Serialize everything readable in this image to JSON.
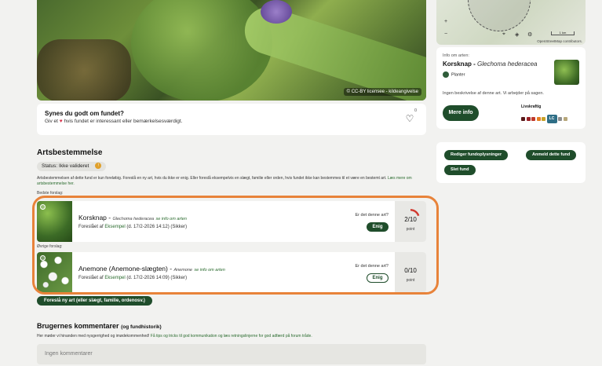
{
  "photo": {
    "credit": "© CC-BY licensee - kildeangivelse"
  },
  "like": {
    "title": "Synes du godt om fundet?",
    "desc_pre": "Giv et",
    "desc_post": "hvis fundet er interessant eller bemærkelsesværdigt.",
    "count": "0"
  },
  "artsbestemmelse": {
    "heading": "Artsbestemmelse",
    "status": "Status: Ikke valideret",
    "description": "Artsbestemmelsen af dette fund er kun foreløbig. Foreslå en ny art, hvis du ikke er enig. Eller foreslå eksempelvis en slægt, familie eller orden, hvis fundet ikke kan bestemmes til et være en bestemt art.",
    "description_link": "Læs mere om artsbestemmelse her.",
    "best_label": "Bedste forslag:",
    "other_label": "Øvrige forslag:",
    "suggestions": [
      {
        "name": "Korsknap",
        "latin": "Glechoma hederacea",
        "more": "se info om arten",
        "by_pre": "Foreslået af",
        "by_user": "Eksempel",
        "by_post": "(d. 17/2-2026 14:12) (Sikker)",
        "question": "Er det denne art?",
        "agree": "Enig",
        "score": "2/10",
        "score_label": "point",
        "progress": 0.2
      },
      {
        "name": "Anemone (Anemone-slægten)",
        "latin": "Anemone",
        "more": "se info om arten",
        "by_pre": "Foreslået af",
        "by_user": "Eksempel",
        "by_post": "(d. 17/2-2026 14:09) (Sikker)",
        "question": "Er det denne art?",
        "agree": "Enig",
        "score": "0/10",
        "score_label": "point",
        "progress": 0
      }
    ],
    "propose_button": "Foreslå ny art (eller slægt, familie, ordenosv.)"
  },
  "comments": {
    "heading": "Brugernes kommentarer",
    "heading_small": "(og fundhistorik)",
    "guide_pre": "Her møder vi hinanden med nysgerrighed og imødekommenhed!",
    "guide_link": "Få tips og tricks til god kommunikation og læs retningslinjerne for god adfærd på forum tråde.",
    "placeholder": "Ingen kommentarer"
  },
  "map": {
    "zoom_in": "+",
    "zoom_out": "−",
    "scale": "1 km",
    "attribution": "OpenStreetMap contributors."
  },
  "species_info": {
    "label": "Info om arten:",
    "name": "Korsknap",
    "latin": "Glechoma hederacea",
    "tag": "Planter",
    "no_desc": "Ingen beskrivelse af denne art. Vi arbejder på sagen.",
    "more_button": "Mere info",
    "redlist_label": "Livskraftig",
    "redlist_value": "LC",
    "redlist_colors": [
      "#5a1a1a",
      "#9b2226",
      "#c0392b",
      "#e67e22",
      "#c9a227",
      "#8e8e8e",
      "#b7a77a"
    ]
  },
  "actions": {
    "edit": "Rediger fundoplysninger",
    "report": "Anmeld dette fund",
    "delete": "Slet fund"
  }
}
